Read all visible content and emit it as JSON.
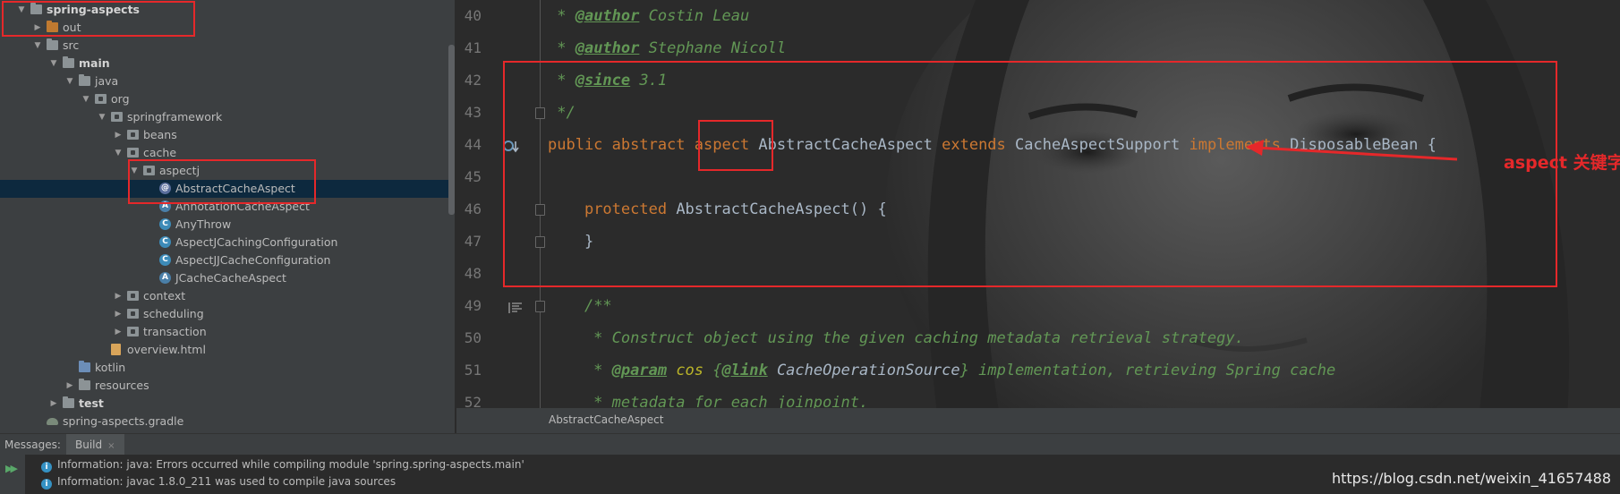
{
  "tree": {
    "rows": [
      {
        "label": "spring-aspects",
        "level": 0,
        "arrow": "down",
        "icon": "folder-icon",
        "bold": true
      },
      {
        "label": "out",
        "level": 1,
        "arrow": "right",
        "icon": "out-folder-icon"
      },
      {
        "label": "src",
        "level": 1,
        "arrow": "down",
        "icon": "folder-icon"
      },
      {
        "label": "main",
        "level": 2,
        "arrow": "down",
        "icon": "folder-icon",
        "bold": true
      },
      {
        "label": "java",
        "level": 3,
        "arrow": "down",
        "icon": "folder-icon"
      },
      {
        "label": "org",
        "level": 4,
        "arrow": "down",
        "icon": "package-icon"
      },
      {
        "label": "springframework",
        "level": 5,
        "arrow": "down",
        "icon": "package-icon"
      },
      {
        "label": "beans",
        "level": 6,
        "arrow": "right",
        "icon": "package-icon"
      },
      {
        "label": "cache",
        "level": 6,
        "arrow": "down",
        "icon": "package-icon"
      },
      {
        "label": "aspectj",
        "level": 7,
        "arrow": "down",
        "icon": "package-icon"
      },
      {
        "label": "AbstractCacheAspect",
        "level": 8,
        "arrow": "",
        "icon": "aspect-icon",
        "selected": true
      },
      {
        "label": "AnnotationCacheAspect",
        "level": 8,
        "arrow": "",
        "icon": "abstract-class-icon"
      },
      {
        "label": "AnyThrow",
        "level": 8,
        "arrow": "",
        "icon": "class-icon"
      },
      {
        "label": "AspectJCachingConfiguration",
        "level": 8,
        "arrow": "",
        "icon": "class-icon"
      },
      {
        "label": "AspectJJCacheConfiguration",
        "level": 8,
        "arrow": "",
        "icon": "class-icon"
      },
      {
        "label": "JCacheCacheAspect",
        "level": 8,
        "arrow": "",
        "icon": "abstract-class-icon"
      },
      {
        "label": "context",
        "level": 6,
        "arrow": "right",
        "icon": "package-icon"
      },
      {
        "label": "scheduling",
        "level": 6,
        "arrow": "right",
        "icon": "package-icon"
      },
      {
        "label": "transaction",
        "level": 6,
        "arrow": "right",
        "icon": "package-icon"
      },
      {
        "label": "overview.html",
        "level": 5,
        "arrow": "",
        "icon": "html-file-icon"
      },
      {
        "label": "kotlin",
        "level": 3,
        "arrow": "",
        "icon": "kotlin-folder-icon"
      },
      {
        "label": "resources",
        "level": 3,
        "arrow": "right",
        "icon": "folder-icon"
      },
      {
        "label": "test",
        "level": 2,
        "arrow": "right",
        "icon": "folder-icon",
        "bold": true
      },
      {
        "label": "spring-aspects.gradle",
        "level": 1,
        "arrow": "",
        "icon": "gradle-file-icon"
      }
    ]
  },
  "editor": {
    "lines": [
      {
        "num": "40",
        "tokens": [
          [
            "cm",
            " * "
          ],
          [
            "tag",
            "@author"
          ],
          [
            "cm",
            " Costin Leau"
          ]
        ]
      },
      {
        "num": "41",
        "tokens": [
          [
            "cm",
            " * "
          ],
          [
            "tag",
            "@author"
          ],
          [
            "cm",
            " Stephane Nicoll"
          ]
        ]
      },
      {
        "num": "42",
        "tokens": [
          [
            "cm",
            " * "
          ],
          [
            "tag",
            "@since"
          ],
          [
            "cm",
            " 3.1"
          ]
        ]
      },
      {
        "num": "43",
        "tokens": [
          [
            "cm",
            " */"
          ]
        ]
      },
      {
        "num": "44",
        "tokens": [
          [
            "kw",
            "public abstract "
          ],
          [
            "kw",
            "aspect "
          ],
          [
            "ty",
            "AbstractCacheAspect "
          ],
          [
            "kw",
            "extends "
          ],
          [
            "ty",
            "CacheAspectSupport "
          ],
          [
            "kw",
            "implements "
          ],
          [
            "ty",
            "DisposableBean {"
          ]
        ]
      },
      {
        "num": "45",
        "tokens": []
      },
      {
        "num": "46",
        "tokens": [
          [
            "ty",
            "    "
          ],
          [
            "kw",
            "protected "
          ],
          [
            "ty",
            "AbstractCacheAspect() {"
          ]
        ]
      },
      {
        "num": "47",
        "tokens": [
          [
            "ty",
            "    }"
          ]
        ]
      },
      {
        "num": "48",
        "tokens": []
      },
      {
        "num": "49",
        "tokens": [
          [
            "ty",
            "    "
          ],
          [
            "cm",
            "/**"
          ]
        ]
      },
      {
        "num": "50",
        "tokens": [
          [
            "cm",
            "     * Construct object using the given caching metadata retrieval strategy."
          ]
        ]
      },
      {
        "num": "51",
        "tokens": [
          [
            "cm",
            "     * "
          ],
          [
            "tag",
            "@param"
          ],
          [
            "param",
            " cos "
          ],
          [
            "cm",
            "{"
          ],
          [
            "tag",
            "@link"
          ],
          [
            "ref",
            " CacheOperationSource"
          ],
          [
            "cm",
            "} implementation, retrieving Spring cache"
          ]
        ]
      },
      {
        "num": "52",
        "tokens": [
          [
            "cm",
            "     * metadata for each joinpoint."
          ]
        ]
      }
    ],
    "breadcrumb": "AbstractCacheAspect",
    "annotation_note": "aspect 关键字 javac 编译器不认识"
  },
  "messages": {
    "header_label": "Messages:",
    "tab_label": "Build",
    "tab_close": "×",
    "rows": [
      "Information: java: Errors occurred while compiling module 'spring.spring-aspects.main'",
      "Information: javac 1.8.0_211 was used to compile java sources"
    ]
  },
  "watermark": "https://blog.csdn.net/weixin_41657488",
  "colors": {
    "annotation_red": "#e5282a",
    "keyword": "#cc7832",
    "comment": "#629755",
    "selection": "#0d293e"
  }
}
